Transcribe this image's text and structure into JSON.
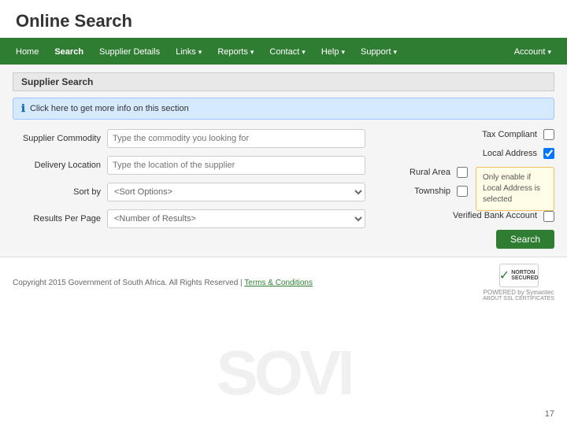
{
  "page": {
    "title": "Online Search",
    "slide_number": "17"
  },
  "navbar": {
    "items": [
      {
        "label": "Home",
        "active": false,
        "has_dropdown": false
      },
      {
        "label": "Search",
        "active": true,
        "has_dropdown": false
      },
      {
        "label": "Supplier Details",
        "active": false,
        "has_dropdown": false
      },
      {
        "label": "Links",
        "active": false,
        "has_dropdown": true
      },
      {
        "label": "Reports",
        "active": false,
        "has_dropdown": true
      },
      {
        "label": "Contact",
        "active": false,
        "has_dropdown": true
      },
      {
        "label": "Help",
        "active": false,
        "has_dropdown": true
      },
      {
        "label": "Support",
        "active": false,
        "has_dropdown": true
      },
      {
        "label": "Account",
        "active": false,
        "has_dropdown": true
      }
    ]
  },
  "section": {
    "title": "Supplier Search",
    "info_text": "Click here to get more info on this section"
  },
  "form": {
    "left": {
      "supplier_commodity": {
        "label": "Supplier Commodity",
        "placeholder": "Type the commodity you looking for"
      },
      "delivery_location": {
        "label": "Delivery Location",
        "placeholder": "Type the location of the supplier"
      },
      "sort_by": {
        "label": "Sort by",
        "placeholder": "<Sort Options>"
      },
      "results_per_page": {
        "label": "Results Per Page",
        "placeholder": "<Number of Results>"
      }
    },
    "right": {
      "tax_compliant": {
        "label": "Tax Compliant",
        "checked": false
      },
      "local_address": {
        "label": "Local Address",
        "checked": true
      },
      "rural_area": {
        "label": "Rural Area",
        "checked": false
      },
      "township": {
        "label": "Township",
        "checked": false
      },
      "verified_bank_account": {
        "label": "Verified Bank Account",
        "checked": false
      }
    },
    "tooltip": "Only enable if Local Address is selected",
    "search_button": "Search"
  },
  "footer": {
    "copyright": "Copyright 2015 Government of South Africa. All Rights Reserved",
    "separator": "|",
    "terms_link": "Terms & Conditions"
  },
  "norton": {
    "text": "POWERED by Symantec",
    "cert_text": "ABOUT SSL CERTIFICATES"
  },
  "watermark": "SOVI"
}
